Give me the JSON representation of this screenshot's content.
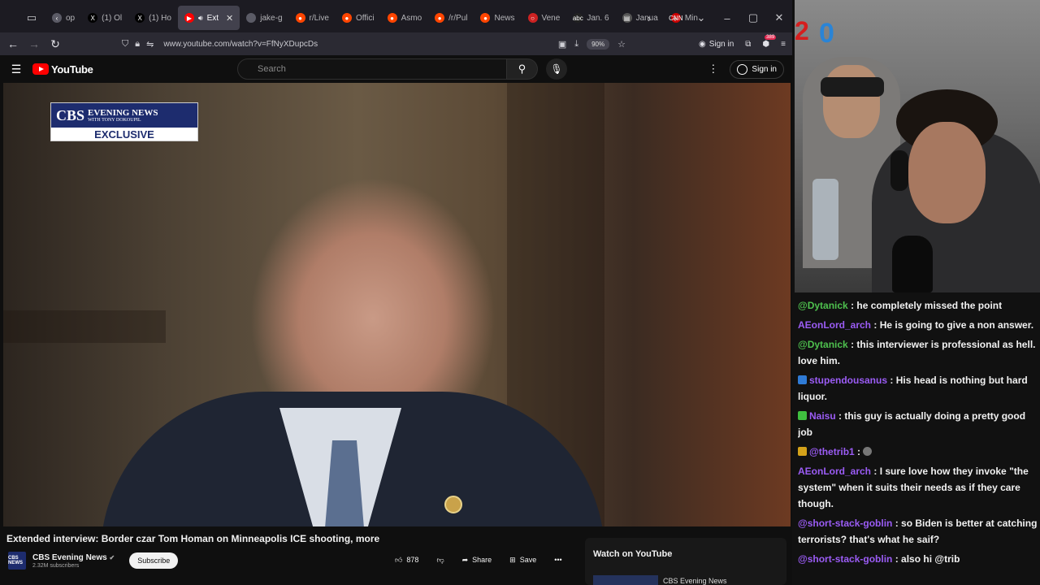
{
  "browser": {
    "tabs": [
      {
        "label": "op",
        "fav": "‹",
        "color": "#5b5b66"
      },
      {
        "label": "(1) Ol",
        "fav": "X",
        "color": "#000000"
      },
      {
        "label": "(1) Ho",
        "fav": "X",
        "color": "#000000"
      },
      {
        "label": "Ext",
        "fav": "▶",
        "color": "#ff0000",
        "active": true
      },
      {
        "label": "jake-g",
        "fav": "",
        "color": "#5b5b66"
      },
      {
        "label": "r/Live",
        "fav": "●",
        "color": "#ff4500"
      },
      {
        "label": "Offici",
        "fav": "●",
        "color": "#ff4500"
      },
      {
        "label": "Asmo",
        "fav": "●",
        "color": "#ff4500"
      },
      {
        "label": "/r/Pul",
        "fav": "●",
        "color": "#ff4500"
      },
      {
        "label": "News",
        "fav": "●",
        "color": "#ff4500"
      },
      {
        "label": "Vene",
        "fav": "○",
        "color": "#c22"
      },
      {
        "label": "Jan. 6",
        "fav": "abc",
        "color": "#222"
      },
      {
        "label": "Janua",
        "fav": "▤",
        "color": "#555"
      },
      {
        "label": "Min",
        "fav": "CNN",
        "color": "#cc0000"
      }
    ],
    "url": "www.youtube.com/watch?v=FfNyXDupcDs",
    "zoom": "90%",
    "signin": "Sign in",
    "ext_badge": "389"
  },
  "youtube": {
    "logo_text": "YouTube",
    "search_placeholder": "Search",
    "signin": "Sign in"
  },
  "video": {
    "overlay_brand": "CBS",
    "overlay_line1": "EVENING NEWS",
    "overlay_line2": "WITH TONY DOKOUPIL",
    "overlay_exclusive": "EXCLUSIVE",
    "title": "Extended interview: Border czar Tom Homan on Minneapolis ICE shooting, more",
    "channel_avatar": "CBS NEWS",
    "channel_name": "CBS Evening News",
    "subscribers": "2.32M subscribers",
    "subscribe_label": "Subscribe",
    "likes": "878",
    "share_label": "Share",
    "save_label": "Save"
  },
  "watch_panel": {
    "title": "Watch on YouTube",
    "item": "CBS Evening News"
  },
  "stream": {
    "badge_red": "2",
    "badge_blue": "0"
  },
  "chat": [
    {
      "user": "@Dytanick",
      "text": "he completely missed the point",
      "green": true,
      "emote": ""
    },
    {
      "user": "AEonLord_arch",
      "text": "He is going to give a non answer.",
      "green": false,
      "emote": ""
    },
    {
      "user": "@Dytanick",
      "text": "this interviewer is professional as hell. love him.",
      "green": true,
      "emote": ""
    },
    {
      "user": "stupendousanus",
      "text": "His head is nothing but hard liquor.",
      "green": false,
      "emote": "#2f7bd6"
    },
    {
      "user": "Naisu",
      "text": "this guy is actually doing a pretty good job",
      "green": false,
      "emote": "#3fbf3f"
    },
    {
      "user": "@thetrib1",
      "text": "",
      "green": false,
      "emote": "#d4a21a"
    },
    {
      "user": "AEonLord_arch",
      "text": "I sure love how they invoke \"the system\" when it suits their needs as if they care though.",
      "green": false,
      "emote": ""
    },
    {
      "user": "@short-stack-goblin",
      "text": "so Biden is better at catching terrorists? that's what he saif?",
      "green": false,
      "emote": ""
    },
    {
      "user": "@short-stack-goblin",
      "text": "also hi @trib",
      "green": false,
      "emote": ""
    }
  ]
}
